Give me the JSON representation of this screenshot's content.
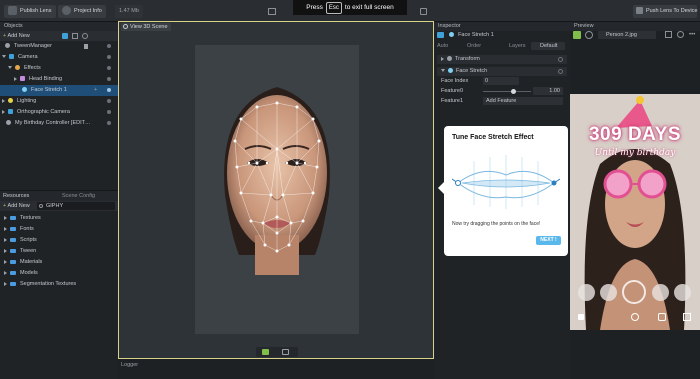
{
  "topbar": {
    "publish_label": "Publish Lens",
    "project_info_label": "Project Info",
    "size_label": "1.47 Mb",
    "push_label": "Push Lens To Device"
  },
  "toast": {
    "prefix": "Press",
    "key": "Esc",
    "suffix": "to exit full screen"
  },
  "objects": {
    "title": "Objects",
    "add_new": "Add New",
    "items": [
      {
        "label": "TweenManager",
        "depth": 0
      },
      {
        "label": "Camera",
        "depth": 0
      },
      {
        "label": "Effects",
        "depth": 1
      },
      {
        "label": "Head Binding",
        "depth": 2
      },
      {
        "label": "Face Stretch 1",
        "depth": 3,
        "selected": true
      },
      {
        "label": "Lighting",
        "depth": 0
      },
      {
        "label": "Orthographic Camera",
        "depth": 0
      },
      {
        "label": "My Birthday Controller [EDIT…",
        "depth": 0
      }
    ]
  },
  "resources": {
    "tab_resources": "Resources",
    "tab_scene_config": "Scene Config",
    "add_new": "Add New",
    "search_value": "GIPHY",
    "items": [
      "Textures",
      "Fonts",
      "Scripts",
      "Tween",
      "Materials",
      "Models",
      "Segmentation Textures"
    ]
  },
  "scene": {
    "title": "View 3D Scene",
    "logger": "Logger"
  },
  "inspector": {
    "title": "Inspector",
    "object_name": "Face Stretch 1",
    "auto_label": "Auto",
    "order_label": "Order",
    "layers_label": "Layers",
    "layer_value": "Default",
    "transform_label": "Transform",
    "face_stretch_label": "Face Stretch",
    "face_index_label": "Face Index",
    "face_index_value": "0",
    "feature0_label": "Feature0",
    "feature0_value": "1.00",
    "feature1_label": "Feature1",
    "add_feature_label": "Add Feature"
  },
  "tooltip": {
    "title": "Tune Face Stretch Effect",
    "body": "Now try dragging the points on the face!",
    "next_label": "NEXT !"
  },
  "preview": {
    "title": "Preview",
    "person_label": "Person 2.jpg",
    "overlay_days": "309 DAYS",
    "overlay_sub": "Until my birthday"
  }
}
